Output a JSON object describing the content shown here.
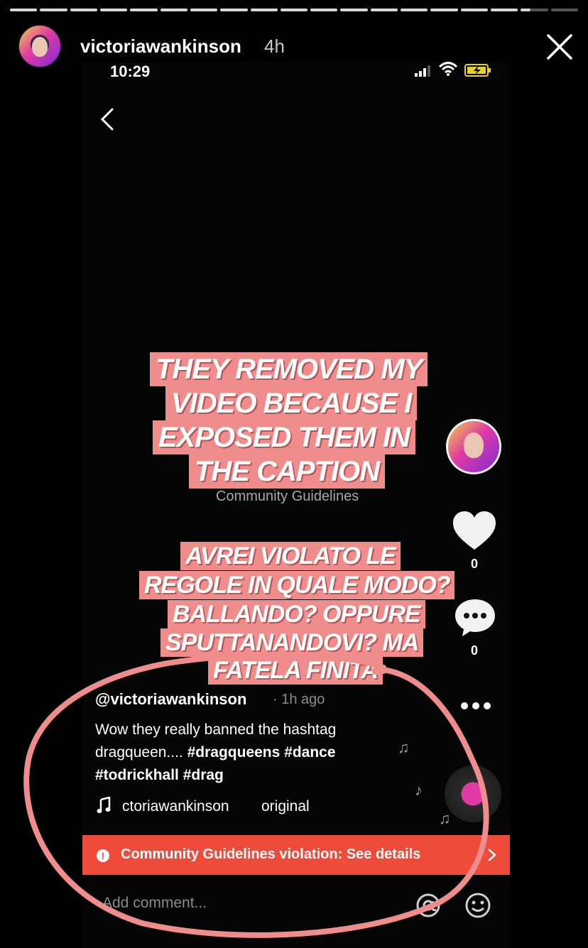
{
  "story": {
    "username": "victoriawankinson",
    "time": "4h",
    "segments": 19,
    "current_segment_progress": 0.35
  },
  "status_bar": {
    "time": "10:29"
  },
  "stickers": {
    "block1": [
      "THEY REMOVED MY",
      "VIDEO BECAUSE I",
      "EXPOSED THEM IN",
      "THE CAPTION"
    ],
    "block2": [
      "AVREI VIOLATO LE",
      "REGOLE IN QUALE MODO?",
      "BALLANDO? OPPURE",
      "SPUTTANANDOVI? MA",
      "FATELA FINITA"
    ]
  },
  "video": {
    "section_label": "Community Guidelines",
    "likes": "0",
    "comments": "0"
  },
  "caption": {
    "handle": "@victoriawankinson",
    "time_ago": "· 1h ago",
    "line1": "Wow they really banned the hashtag",
    "line2_text": "dragqueen.... ",
    "line2_tags": "#dragqueens #dance",
    "line3": "#todrickhall #drag",
    "sound_user": "ctoriawankinson",
    "sound_label": "original"
  },
  "banner": {
    "text": "Community Guidelines violation: See details",
    "icon": "!"
  },
  "comment_input": {
    "placeholder": "Add comment..."
  },
  "colors": {
    "sticker_bg": "#ef8d8d",
    "banner_bg": "#ee4b3b",
    "loop_stroke": "#ef8d8d",
    "background": "#000000"
  },
  "icons": [
    "close-icon",
    "back-chevron-icon",
    "heart-icon",
    "comment-bubble-icon",
    "more-dots-icon",
    "music-note-icon",
    "alert-icon",
    "chevron-right-icon",
    "at-icon",
    "emoji-icon"
  ]
}
